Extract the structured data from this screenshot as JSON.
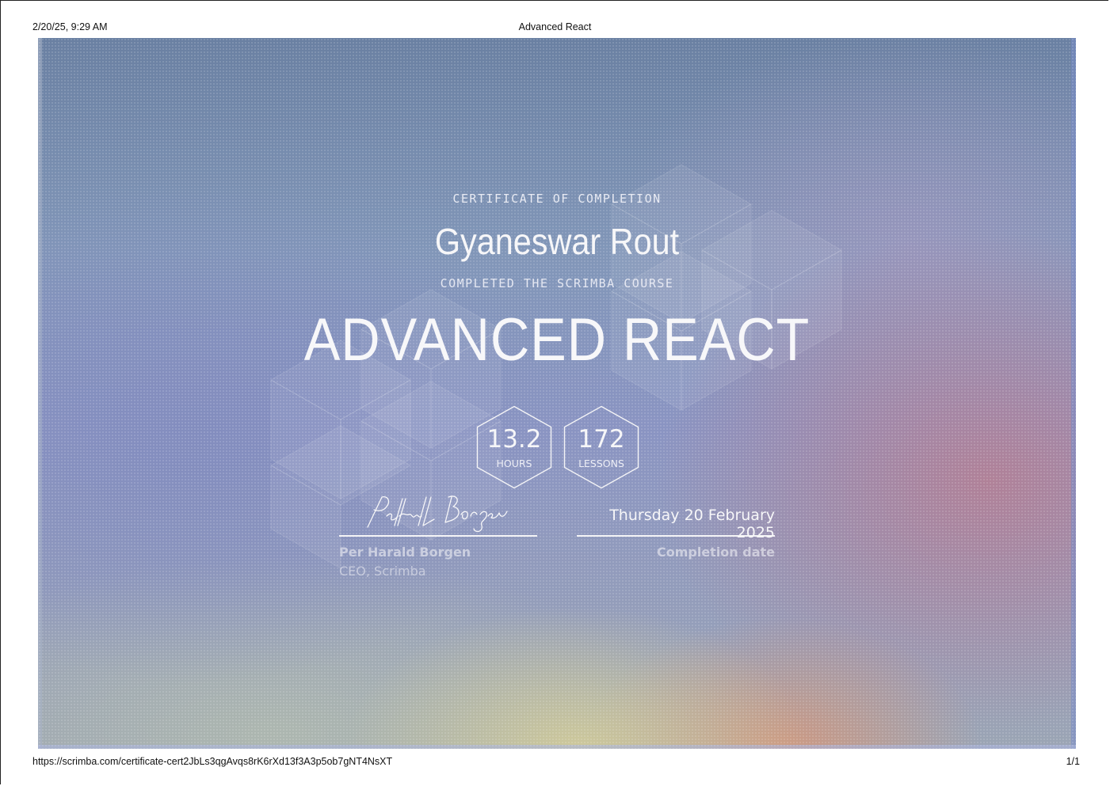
{
  "print_header": {
    "datetime": "2/20/25, 9:29 AM",
    "title": "Advanced React"
  },
  "print_footer": {
    "url": "https://scrimba.com/certificate-cert2JbLs3qgAvqs8rK6rXd13f3A3p5ob7gNT4NsXT",
    "page": "1/1"
  },
  "certificate": {
    "label": "CERTIFICATE OF COMPLETION",
    "recipient": "Gyaneswar Rout",
    "completed_label": "COMPLETED THE SCRIMBA COURSE",
    "course": "ADVANCED REACT",
    "stats": [
      {
        "value": "13.2",
        "unit": "HOURS"
      },
      {
        "value": "172",
        "unit": "LESSONS"
      }
    ],
    "signature": {
      "signer_name": "Per Harald Borgen",
      "signer_title": "CEO, Scrimba"
    },
    "completion": {
      "date": "Thursday 20 February 2025",
      "label": "Completion date"
    }
  },
  "colors": {
    "background_top": "#6a80a2",
    "background_mid": "#8a94c2",
    "accent_pink": "#b28096",
    "accent_yellow": "#d6ce96",
    "text": "#f6f6f8"
  }
}
